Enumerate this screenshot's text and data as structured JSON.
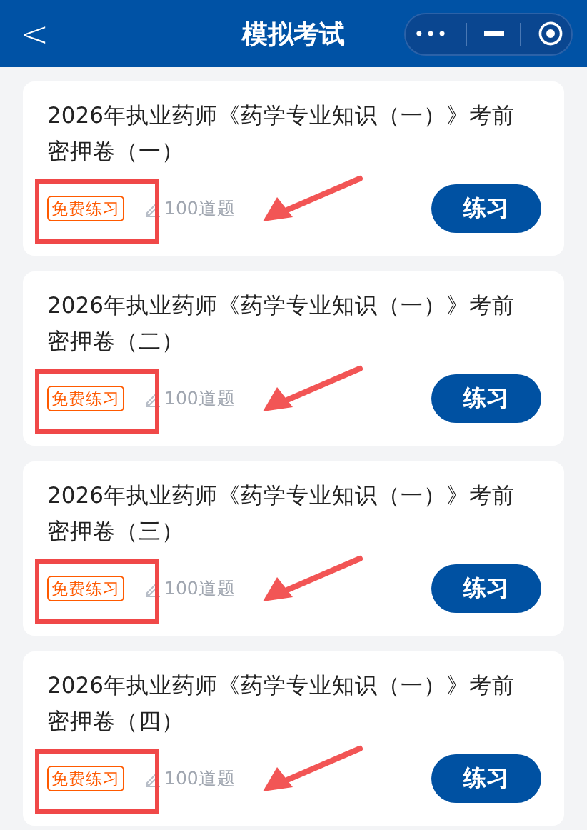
{
  "header": {
    "back": "<",
    "title": "模拟考试",
    "capsule": {
      "more": "•••"
    }
  },
  "papers": [
    {
      "title": "2026年执业药师《药学专业知识（一）》考前密押卷（一）",
      "tag": "免费练习",
      "count": "100道题",
      "button": "练习"
    },
    {
      "title": "2026年执业药师《药学专业知识（一）》考前密押卷（二）",
      "tag": "免费练习",
      "count": "100道题",
      "button": "练习"
    },
    {
      "title": "2026年执业药师《药学专业知识（一）》考前密押卷（三）",
      "tag": "免费练习",
      "count": "100道题",
      "button": "练习"
    },
    {
      "title": "2026年执业药师《药学专业知识（一）》考前密押卷（四）",
      "tag": "免费练习",
      "count": "100道题",
      "button": "练习"
    }
  ]
}
